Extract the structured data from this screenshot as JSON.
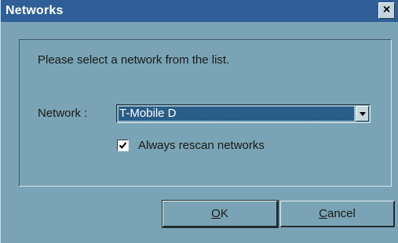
{
  "window": {
    "title": "Networks",
    "close_glyph": "×"
  },
  "dialog": {
    "prompt": "Please select a network from the list.",
    "network_label": "Network :",
    "network_selected": "T-Mobile D",
    "dropdown_icon": "chevron-down-icon",
    "checkbox_label": "Always rescan networks",
    "checkbox_checked": true
  },
  "buttons": {
    "ok_mnemonic": "O",
    "ok_rest": "K",
    "cancel_mnemonic": "C",
    "cancel_rest": "ancel"
  },
  "colors": {
    "titlebar": "#2f5f96",
    "dialog_bg": "#7aa4b5",
    "selection": "#2a5d88"
  }
}
